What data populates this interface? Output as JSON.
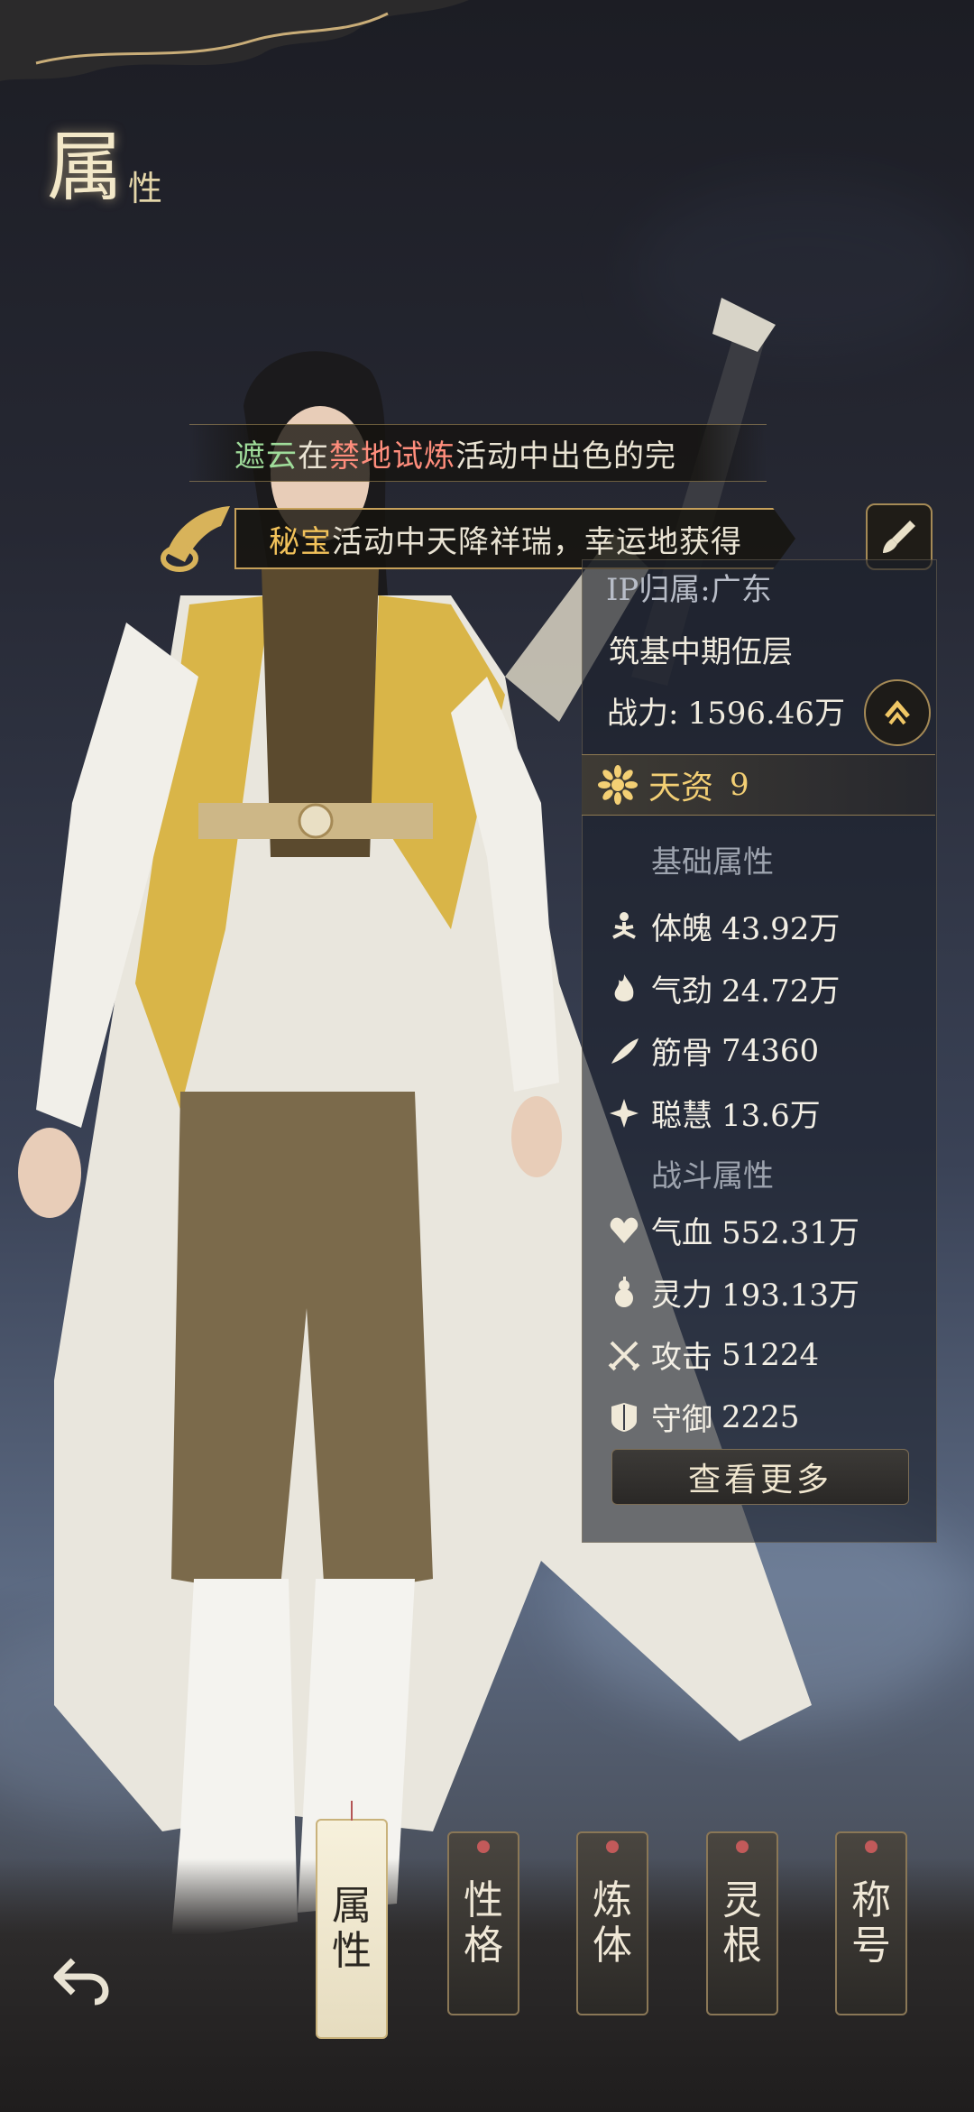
{
  "header": {
    "title_big": "属",
    "title_small": "性"
  },
  "marquee": {
    "line1": {
      "name": "遮云",
      "mid1": "在",
      "event": "禁地试炼",
      "rest": "活动中出色的完"
    },
    "line2": {
      "event": "秘宝",
      "rest": "活动中天降祥瑞，幸运地获得"
    }
  },
  "profile": {
    "ip": "IP归属:广东",
    "realm": "筑基中期伍层",
    "power_label": "战力:",
    "power_value": "1596.46万"
  },
  "talent": {
    "label": "天资",
    "value": "9"
  },
  "basic_section": "基础属性",
  "basic_stats": [
    {
      "label": "体魄",
      "value": "43.92万",
      "icon": "meditation-icon"
    },
    {
      "label": "气劲",
      "value": "24.72万",
      "icon": "flame-icon"
    },
    {
      "label": "筋骨",
      "value": "74360",
      "icon": "feather-icon"
    },
    {
      "label": "聪慧",
      "value": "13.6万",
      "icon": "sparkle-icon"
    }
  ],
  "combat_section": "战斗属性",
  "combat_stats": [
    {
      "label": "气血",
      "value": "552.31万",
      "icon": "heart-icon"
    },
    {
      "label": "灵力",
      "value": "193.13万",
      "icon": "gourd-icon"
    },
    {
      "label": "攻击",
      "value": "51224",
      "icon": "crossed-swords-icon"
    },
    {
      "label": "守御",
      "value": "2225",
      "icon": "shield-icon"
    }
  ],
  "more_button": "查看更多",
  "tabs": [
    {
      "chars": [
        "属",
        "性"
      ],
      "active": true
    },
    {
      "chars": [
        "性",
        "格"
      ],
      "active": false
    },
    {
      "chars": [
        "炼",
        "体"
      ],
      "active": false
    },
    {
      "chars": [
        "灵",
        "根"
      ],
      "active": false
    },
    {
      "chars": [
        "称",
        "号"
      ],
      "active": false
    }
  ],
  "colors": {
    "accent_gold": "#f3cf74",
    "highlight_green": "#9fdc9a",
    "highlight_red": "#ff8d7c"
  }
}
